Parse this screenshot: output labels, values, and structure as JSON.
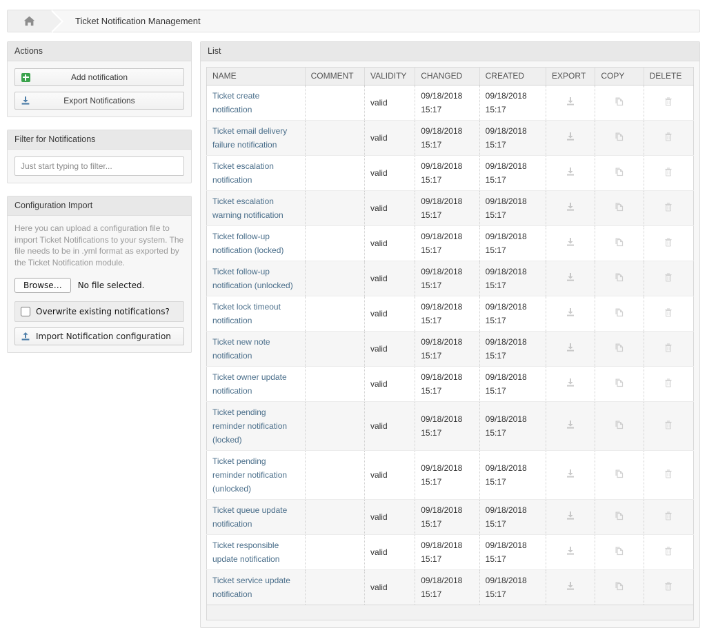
{
  "breadcrumb": {
    "home_icon": "home-icon",
    "title": "Ticket Notification Management"
  },
  "sidebar": {
    "actions": {
      "header": "Actions",
      "buttons": [
        {
          "label": "Add notification",
          "icon": "plus-square-icon"
        },
        {
          "label": "Export Notifications",
          "icon": "download-icon"
        }
      ]
    },
    "filter": {
      "header": "Filter for Notifications",
      "placeholder": "Just start typing to filter...",
      "value": ""
    },
    "config_import": {
      "header": "Configuration Import",
      "description": "Here you can upload a configuration file to import Ticket Notifications to your system. The file needs to be in .yml format as exported by the Ticket Notification module.",
      "browse_label": "Browse…",
      "file_status": "No file selected.",
      "overwrite_label": "Overwrite existing notifications?",
      "overwrite_checked": false,
      "import_label": "Import Notification configuration",
      "import_icon": "upload-icon"
    }
  },
  "main": {
    "list": {
      "header": "List",
      "columns": [
        "NAME",
        "COMMENT",
        "VALIDITY",
        "CHANGED",
        "CREATED",
        "EXPORT",
        "COPY",
        "DELETE"
      ],
      "row_icons": {
        "export": "download-icon",
        "copy": "copy-icon",
        "delete": "trash-icon"
      },
      "rows": [
        {
          "name": "Ticket create notification",
          "comment": "",
          "validity": "valid",
          "changed": "09/18/2018 15:17",
          "created": "09/18/2018 15:17"
        },
        {
          "name": "Ticket email delivery failure notification",
          "comment": "",
          "validity": "valid",
          "changed": "09/18/2018 15:17",
          "created": "09/18/2018 15:17"
        },
        {
          "name": "Ticket escalation notification",
          "comment": "",
          "validity": "valid",
          "changed": "09/18/2018 15:17",
          "created": "09/18/2018 15:17"
        },
        {
          "name": "Ticket escalation warning notification",
          "comment": "",
          "validity": "valid",
          "changed": "09/18/2018 15:17",
          "created": "09/18/2018 15:17"
        },
        {
          "name": "Ticket follow-up notification (locked)",
          "comment": "",
          "validity": "valid",
          "changed": "09/18/2018 15:17",
          "created": "09/18/2018 15:17"
        },
        {
          "name": "Ticket follow-up notification (unlocked)",
          "comment": "",
          "validity": "valid",
          "changed": "09/18/2018 15:17",
          "created": "09/18/2018 15:17"
        },
        {
          "name": "Ticket lock timeout notification",
          "comment": "",
          "validity": "valid",
          "changed": "09/18/2018 15:17",
          "created": "09/18/2018 15:17"
        },
        {
          "name": "Ticket new note notification",
          "comment": "",
          "validity": "valid",
          "changed": "09/18/2018 15:17",
          "created": "09/18/2018 15:17"
        },
        {
          "name": "Ticket owner update notification",
          "comment": "",
          "validity": "valid",
          "changed": "09/18/2018 15:17",
          "created": "09/18/2018 15:17"
        },
        {
          "name": "Ticket pending reminder notification (locked)",
          "comment": "",
          "validity": "valid",
          "changed": "09/18/2018 15:17",
          "created": "09/18/2018 15:17"
        },
        {
          "name": "Ticket pending reminder notification (unlocked)",
          "comment": "",
          "validity": "valid",
          "changed": "09/18/2018 15:17",
          "created": "09/18/2018 15:17"
        },
        {
          "name": "Ticket queue update notification",
          "comment": "",
          "validity": "valid",
          "changed": "09/18/2018 15:17",
          "created": "09/18/2018 15:17"
        },
        {
          "name": "Ticket responsible update notification",
          "comment": "",
          "validity": "valid",
          "changed": "09/18/2018 15:17",
          "created": "09/18/2018 15:17"
        },
        {
          "name": "Ticket service update notification",
          "comment": "",
          "validity": "valid",
          "changed": "09/18/2018 15:17",
          "created": "09/18/2018 15:17"
        }
      ]
    }
  },
  "colors": {
    "link": "#4a6e8a",
    "accent_green": "#3aa34c",
    "accent_blue": "#4d7ea8",
    "widget_header": "#e8e8e8"
  }
}
